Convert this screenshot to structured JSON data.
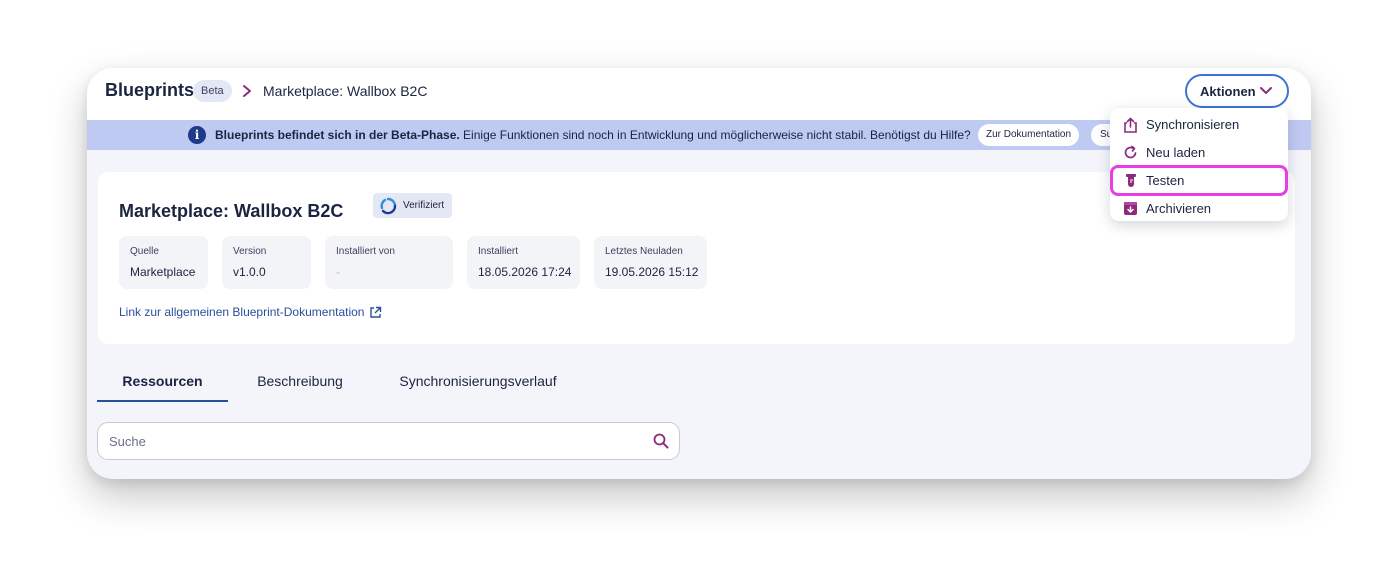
{
  "header": {
    "brand": "Blueprints",
    "beta_badge": "Beta",
    "breadcrumb_current": "Marketplace: Wallbox B2C",
    "actions_label": "Aktionen"
  },
  "banner": {
    "bold_text": "Blueprints befindet sich in der Beta-Phase.",
    "text": " Einige Funktionen sind noch in Entwicklung und möglicherweise nicht stabil. Benötigst du Hilfe?",
    "doc_button": "Zur Dokumentation",
    "support_button": "Su"
  },
  "card": {
    "title": "Marketplace: Wallbox B2C",
    "verified_badge": "Verifiziert",
    "meta": [
      {
        "label": "Quelle",
        "value": "Marketplace"
      },
      {
        "label": "Version",
        "value": "v1.0.0"
      },
      {
        "label": "Installiert von",
        "value": "-"
      },
      {
        "label": "Installiert",
        "value": "18.05.2026 17:24"
      },
      {
        "label": "Letztes Neuladen",
        "value": "19.05.2026 15:12"
      }
    ],
    "doc_link": "Link zur allgemeinen Blueprint-Dokumentation"
  },
  "tabs": [
    {
      "label": "Ressourcen",
      "active": true
    },
    {
      "label": "Beschreibung",
      "active": false
    },
    {
      "label": "Synchronisierungsverlauf",
      "active": false
    }
  ],
  "search": {
    "placeholder": "Suche",
    "value": ""
  },
  "dropdown": {
    "items": [
      {
        "label": "Synchronisieren",
        "icon": "share-upload-icon"
      },
      {
        "label": "Neu laden",
        "icon": "reload-icon"
      },
      {
        "label": "Testen",
        "icon": "test-tube-icon",
        "highlighted": true
      },
      {
        "label": "Archivieren",
        "icon": "archive-icon"
      }
    ]
  },
  "colors": {
    "accent_blue": "#3b74d6",
    "banner_bg": "#bfcaf3",
    "dropdown_icon": "#8c2a7c",
    "highlight": "#e83de0"
  }
}
